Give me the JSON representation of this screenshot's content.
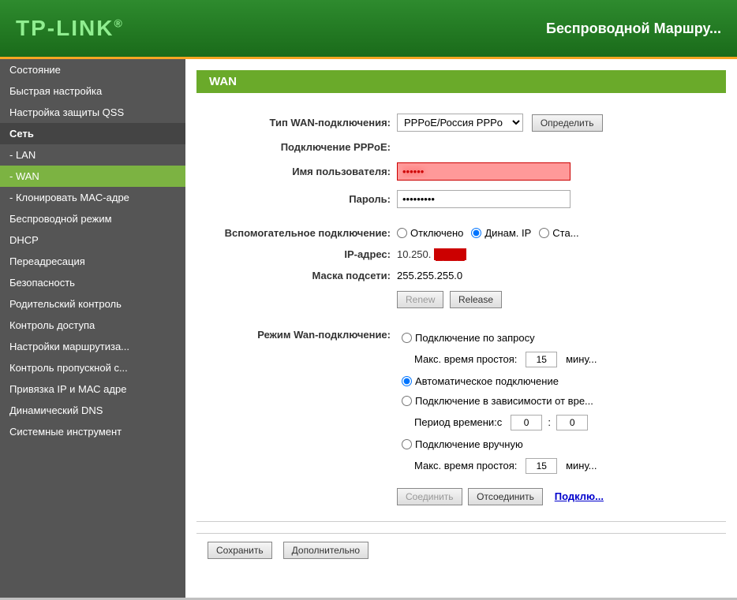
{
  "header": {
    "logo": "TP-LINK",
    "logo_trademark": "®",
    "title": "Беспроводной Маршру..."
  },
  "sidebar": {
    "items": [
      {
        "id": "status",
        "label": "Состояние",
        "active": false
      },
      {
        "id": "quick-setup",
        "label": "Быстрая настройка",
        "active": false
      },
      {
        "id": "qss",
        "label": "Настройка защиты QSS",
        "active": false
      },
      {
        "id": "network",
        "label": "Сеть",
        "active": false,
        "section": true
      },
      {
        "id": "lan",
        "label": "- LAN",
        "active": false
      },
      {
        "id": "wan",
        "label": "- WAN",
        "active": true
      },
      {
        "id": "mac-clone",
        "label": "- Клонировать MAC-адре",
        "active": false
      },
      {
        "id": "wireless",
        "label": "Беспроводной режим",
        "active": false
      },
      {
        "id": "dhcp",
        "label": "DHCP",
        "active": false
      },
      {
        "id": "forwarding",
        "label": "Переадресация",
        "active": false
      },
      {
        "id": "security",
        "label": "Безопасность",
        "active": false
      },
      {
        "id": "parental",
        "label": "Родительский контроль",
        "active": false
      },
      {
        "id": "access-control",
        "label": "Контроль доступа",
        "active": false
      },
      {
        "id": "routing",
        "label": "Настройки маршрутиза...",
        "active": false
      },
      {
        "id": "bandwidth",
        "label": "Контроль пропускной с...",
        "active": false
      },
      {
        "id": "ip-mac",
        "label": "Привязка IP и МАС адре",
        "active": false
      },
      {
        "id": "ddns",
        "label": "Динамический DNS",
        "active": false
      },
      {
        "id": "tools",
        "label": "Системные инструмент",
        "active": false
      }
    ]
  },
  "page": {
    "title": "WAN"
  },
  "form": {
    "wan_type_label": "Тип WAN-подключения:",
    "wan_type_value": "PPPoE/Россия PPPo",
    "detect_button": "Определить",
    "pppoe_label": "Подключение PPPoE:",
    "username_label": "Имя пользователя:",
    "username_value": "••••••",
    "password_label": "Пароль:",
    "password_value": "•••••••••",
    "secondary_label": "Вспомогательное подключение:",
    "radio_off": "Отключено",
    "radio_dynamic_ip": "Динам. IP",
    "radio_static": "Ста...",
    "ip_label": "IP-адрес:",
    "ip_value": "10.250.███.███",
    "subnet_label": "Маска подсети:",
    "subnet_value": "255.255.255.0",
    "renew_button": "Renew",
    "release_button": "Release",
    "conn_mode_label": "Режим Wan-подключение:",
    "on_demand_label": "Подключение по запросу",
    "max_idle_label": "Макс. время простоя:",
    "max_idle_value1": "15",
    "minutes_label1": "мину...",
    "auto_connect_label": "Автоматическое подключение",
    "time_based_label": "Подключение в зависимости от вре...",
    "period_label": "Период времени:с",
    "period_from": "0",
    "period_to": "0",
    "manual_label": "Подключение вручную",
    "max_idle_label2": "Макс. время простоя:",
    "max_idle_value2": "15",
    "minutes_label2": "мину...",
    "connect_button": "Соединить",
    "disconnect_button": "Отсоединить",
    "connect_link": "Подклю...",
    "save_button": "Сохранить",
    "advanced_button": "Дополнительно"
  }
}
